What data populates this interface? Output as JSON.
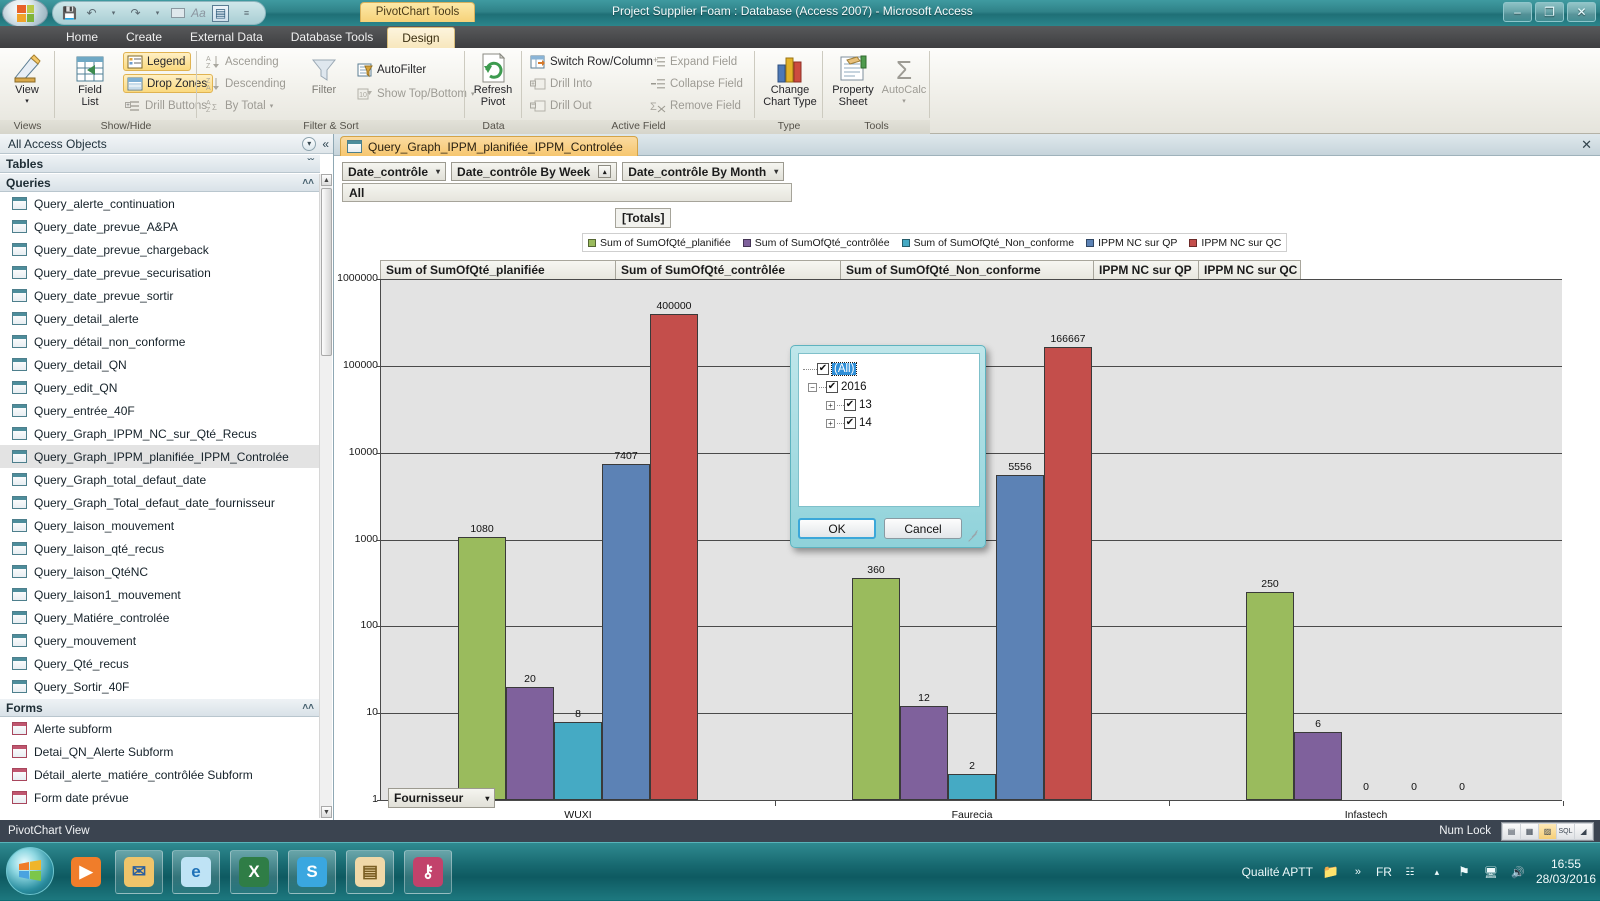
{
  "window": {
    "title": "Project Supplier Foam : Database (Access 2007)  -  Microsoft Access",
    "contextual_tab_title": "PivotChart Tools",
    "minimize": "–",
    "restore": "❐",
    "close": "✕"
  },
  "quick_access": {
    "save": "save-icon",
    "undo": "undo-icon",
    "undo_more": "▾",
    "redo": "redo-icon",
    "redo_more": "▾",
    "window_icon": "window-icon",
    "font_icon": "Aa",
    "pivot_icon": "pivotchart-icon",
    "customize": "≡"
  },
  "ribbon": {
    "tabs": [
      {
        "label": "Home",
        "active": false
      },
      {
        "label": "Create",
        "active": false
      },
      {
        "label": "External Data",
        "active": false
      },
      {
        "label": "Database Tools",
        "active": false
      },
      {
        "label": "Design",
        "active": true
      }
    ],
    "groups": [
      {
        "name": "Views",
        "label": "Views"
      },
      {
        "name": "Show/Hide",
        "label": "Show/Hide"
      },
      {
        "name": "Filter & Sort",
        "label": "Filter & Sort"
      },
      {
        "name": "Data",
        "label": "Data"
      },
      {
        "name": "Active Field",
        "label": "Active Field"
      },
      {
        "name": "Type",
        "label": "Type"
      },
      {
        "name": "Tools",
        "label": "Tools"
      }
    ],
    "view_button": {
      "line1": "View",
      "caret": "▾"
    },
    "field_list": {
      "line1": "Field",
      "line2": "List"
    },
    "showhide": [
      {
        "label": "Legend",
        "state": "highlighted"
      },
      {
        "label": "Drop Zones",
        "state": "highlighted"
      },
      {
        "label": "Drill Buttons",
        "state": "disabled"
      }
    ],
    "sort": [
      {
        "label": "Ascending",
        "state": "disabled"
      },
      {
        "label": "Descending",
        "state": "disabled"
      },
      {
        "label": "By Total",
        "state": "disabled",
        "caret": "▾"
      }
    ],
    "filter_button": {
      "label": "Filter"
    },
    "filter_items": [
      {
        "label": "AutoFilter",
        "state": "normal"
      },
      {
        "label": "Show Top/Bottom",
        "state": "disabled",
        "caret": "▾"
      }
    ],
    "refresh_pivot": {
      "line1": "Refresh",
      "line2": "Pivot"
    },
    "active_field": [
      {
        "label": "Switch Row/Column",
        "state": "normal"
      },
      {
        "label": "Drill Into",
        "state": "disabled"
      },
      {
        "label": "Drill Out",
        "state": "disabled"
      },
      {
        "label": "Expand Field",
        "state": "disabled"
      },
      {
        "label": "Collapse Field",
        "state": "disabled"
      },
      {
        "label": "Remove Field",
        "state": "disabled"
      }
    ],
    "change_chart_type": {
      "line1": "Change",
      "line2": "Chart Type"
    },
    "property_sheet": {
      "line1": "Property",
      "line2": "Sheet"
    },
    "autocalc": {
      "line1": "AutoCalc",
      "caret": "▾"
    }
  },
  "nav_pane": {
    "header": "All Access Objects",
    "header_dropdown": "▾",
    "collapse": "«",
    "groups": [
      {
        "title": "Tables",
        "chevron": "ˇˇ",
        "items": []
      },
      {
        "title": "Queries",
        "chevron": "˄˄",
        "items": [
          {
            "label": "Query_alerte_continuation",
            "selected": false
          },
          {
            "label": "Query_date_prevue_A&PA",
            "selected": false
          },
          {
            "label": "Query_date_prevue_chargeback",
            "selected": false
          },
          {
            "label": "Query_date_prevue_securisation",
            "selected": false
          },
          {
            "label": "Query_date_prevue_sortir",
            "selected": false
          },
          {
            "label": "Query_detail_alerte",
            "selected": false
          },
          {
            "label": "Query_détail_non_conforme",
            "selected": false
          },
          {
            "label": "Query_detail_QN",
            "selected": false
          },
          {
            "label": "Query_edit_QN",
            "selected": false
          },
          {
            "label": "Query_entrée_40F",
            "selected": false
          },
          {
            "label": "Query_Graph_IPPM_NC_sur_Qté_Recus",
            "selected": false
          },
          {
            "label": "Query_Graph_IPPM_planifiée_IPPM_Controlée",
            "selected": true
          },
          {
            "label": "Query_Graph_total_defaut_date",
            "selected": false
          },
          {
            "label": "Query_Graph_Total_defaut_date_fournisseur",
            "selected": false
          },
          {
            "label": "Query_laison_mouvement",
            "selected": false
          },
          {
            "label": "Query_laison_qté_recus",
            "selected": false
          },
          {
            "label": "Query_laison_QtéNC",
            "selected": false
          },
          {
            "label": "Query_laison1_mouvement",
            "selected": false
          },
          {
            "label": "Query_Matiére_controlée",
            "selected": false
          },
          {
            "label": "Query_mouvement",
            "selected": false
          },
          {
            "label": "Query_Qté_recus",
            "selected": false
          },
          {
            "label": "Query_Sortir_40F",
            "selected": false
          }
        ]
      },
      {
        "title": "Forms",
        "chevron": "˄˄",
        "items": [
          {
            "label": "Alerte subform",
            "selected": false
          },
          {
            "label": "Detai_QN_Alerte Subform",
            "selected": false
          },
          {
            "label": "Détail_alerte_matiére_contrôlée Subform",
            "selected": false
          },
          {
            "label": "Form date prévue",
            "selected": false
          }
        ]
      }
    ]
  },
  "document": {
    "tab_label": "Query_Graph_IPPM_planifiée_IPPM_Controlée",
    "close_label": "✕"
  },
  "pivot": {
    "filter_fields": [
      {
        "label": "Date_contrôle",
        "arrow": "▾",
        "boxed": false
      },
      {
        "label": "Date_contrôle By Week",
        "arrow": "▴",
        "boxed": true
      },
      {
        "label": "Date_contrôle By Month",
        "arrow": "▾",
        "boxed": false
      }
    ],
    "all_row": "All",
    "totals_label": "[Totals]",
    "category_field": {
      "label": "Fournisseur",
      "arrow": "▾"
    }
  },
  "popup": {
    "items": [
      {
        "label": "(All)",
        "checked": true,
        "expander": "none",
        "selected": true,
        "indent": 0
      },
      {
        "label": "2016",
        "checked": true,
        "expander": "minus",
        "selected": false,
        "indent": 0
      },
      {
        "label": "13",
        "checked": true,
        "expander": "plus",
        "selected": false,
        "indent": 1
      },
      {
        "label": "14",
        "checked": true,
        "expander": "plus",
        "selected": false,
        "indent": 1
      }
    ],
    "ok_label": "OK",
    "cancel_label": "Cancel",
    "check_glyph": "✔",
    "minus_glyph": "−",
    "plus_glyph": "+"
  },
  "chart_data": {
    "type": "bar",
    "title": "",
    "xlabel": "Fournisseur",
    "ylabel": "",
    "yscale": "log",
    "ylim": [
      1,
      1000000
    ],
    "yticks": [
      1,
      10,
      100,
      1000,
      10000,
      100000,
      1000000
    ],
    "ytick_labels": [
      "1",
      "10",
      "100",
      "1000",
      "10000",
      "100000",
      "1000000"
    ],
    "grid": true,
    "legend_position": "top",
    "categories": [
      "WUXI",
      "Faurecia",
      "Infastech"
    ],
    "series": [
      {
        "name": "Sum of SumOfQté_planifiée",
        "color": "#9ABB5D",
        "values": [
          1080,
          360,
          250
        ],
        "labels": [
          "1080",
          "360",
          "250"
        ]
      },
      {
        "name": "Sum of SumOfQté_contrôlée",
        "color": "#7F619C",
        "values": [
          20,
          12,
          6
        ],
        "labels": [
          "20",
          "12",
          "6"
        ]
      },
      {
        "name": "Sum of SumOfQté_Non_conforme",
        "color": "#45AAC4",
        "values": [
          8,
          2,
          0
        ],
        "labels": [
          "8",
          "2",
          "0"
        ]
      },
      {
        "name": "IPPM NC sur QP",
        "color": "#5C82B5",
        "values": [
          7407,
          5556,
          0
        ],
        "labels": [
          "7407",
          "5556",
          "0"
        ]
      },
      {
        "name": "IPPM NC sur QC",
        "color": "#C44E4B",
        "values": [
          400000,
          166667,
          0
        ],
        "labels": [
          "400000",
          "166667",
          "0"
        ]
      }
    ],
    "column_headers": [
      "Sum of SumOfQté_planifiée",
      "Sum of SumOfQté_contrôlée",
      "Sum of SumOfQté_Non_conforme",
      "IPPM NC sur QP",
      "IPPM NC sur QC"
    ]
  },
  "status_bar": {
    "view_text": "PivotChart View",
    "num_lock": "Num Lock",
    "view_buttons": [
      {
        "name": "datasheet-view",
        "glyph": "▤",
        "active": false
      },
      {
        "name": "pivottable-view",
        "glyph": "▦",
        "active": false
      },
      {
        "name": "pivotchart-view",
        "glyph": "▨",
        "active": true
      },
      {
        "name": "sql-view",
        "glyph": "SQL",
        "active": false
      },
      {
        "name": "design-view",
        "glyph": "◢",
        "active": false
      }
    ]
  },
  "taskbar": {
    "start": "start-orb",
    "apps": [
      {
        "name": "windows-media-player",
        "glyph": "▶"
      },
      {
        "name": "outlook",
        "glyph": "✉"
      },
      {
        "name": "internet-explorer",
        "glyph": "e"
      },
      {
        "name": "excel",
        "glyph": "X"
      },
      {
        "name": "skype",
        "glyph": "S"
      },
      {
        "name": "explorer",
        "glyph": "▤"
      },
      {
        "name": "access",
        "glyph": "⚷"
      }
    ],
    "tray": {
      "user": "Qualité APTT",
      "folder_icon": "folder-icon",
      "overflow": "»",
      "language": "FR",
      "network_icon": "network-icon",
      "show_hidden": "▴",
      "action_center": "flag-icon",
      "display_icon": "display-icon",
      "volume_icon": "volume-muted-icon",
      "time": "16:55",
      "date": "28/03/2016"
    }
  }
}
